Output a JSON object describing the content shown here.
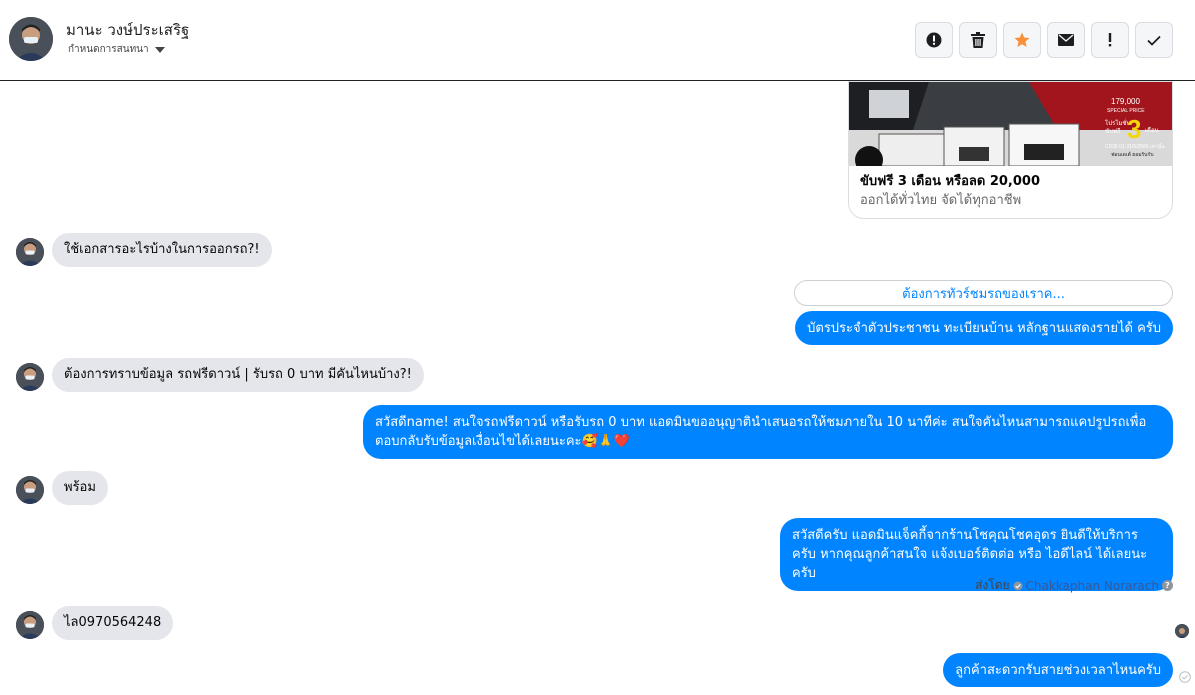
{
  "header": {
    "contact_name": "มานะ วงษ์ประเสริฐ",
    "conversation_status": "กำหนดการสนทนา"
  },
  "actions": [
    {
      "name": "spam-button",
      "icon": "alert-circle-icon"
    },
    {
      "name": "delete-button",
      "icon": "trash-icon"
    },
    {
      "name": "star-button",
      "icon": "star-icon",
      "color": "#f7923b"
    },
    {
      "name": "mark-unread-button",
      "icon": "envelope-icon"
    },
    {
      "name": "important-button",
      "icon": "exclamation-icon"
    },
    {
      "name": "done-button",
      "icon": "check-icon"
    }
  ],
  "card": {
    "title": "ขับฟรี 3 เดือน หรือลด 20,000",
    "subtitle": "ออกได้ทั่วไทย จัดได้ทุกอาชีพ",
    "image_text": {
      "price": "179,000",
      "special": "SPECIAL PRICE",
      "promo_line1": "โปรโมชั่น",
      "promo_line2": "ขับฟรี",
      "big_number": "3",
      "months": "เดือน",
      "footer1": "CD35  01-31/5/2566 เท่านั้น",
      "footer2": "ฟอนเดเต้ ยอมรับกับ"
    }
  },
  "messages": {
    "m1": "ใช้เอกสารอะไรบ้างในการออกรถ?!",
    "quick_reply": "ต้องการทัวร์ชมรถของเราค...",
    "m2": "บัตรประจำตัวประชาชน ทะเบียนบ้าน หลักฐานแสดงรายได้ ครับ",
    "m3": "ต้องการทราบข้อมูล รถฟรีดาวน์ | รับรถ 0 บาท มีคันไหนบ้าง?!",
    "m4": "สวัสดีname! สนใจรถฟรีดาวน์ หรือรับรถ 0 บาท แอดมินขออนุญาตินำเสนอรถให้ชมภายใน 10 นาทีค่ะ สนใจคันไหนสามารถแคปรูปรถเพื่อตอบกลับรับข้อมูลเงื่อนไขได้เลยนะคะ🥰🙏❤️",
    "m5": "พร้อม",
    "m6": "สวัสดีครับ แอดมินแจ็คกี้จากร้านโชคุณโชคอุดร ยินดีให้บริการครับ หากคุณลูกค้าสนใจ แจ้งเบอร์ติดต่อ หรือ ไอดีไลน์ ได้เลยนะครับ",
    "m7": "ไล0970564248",
    "m8": "ลูกค้าสะดวกรับสายช่วงเวลาไหนครับ"
  },
  "sent_by": {
    "label": "ส่งโดย",
    "name": "Chakkaphan Norarach",
    "help": "?"
  },
  "colors": {
    "outgoing": "#0084ff",
    "incoming": "#e4e6eb"
  }
}
